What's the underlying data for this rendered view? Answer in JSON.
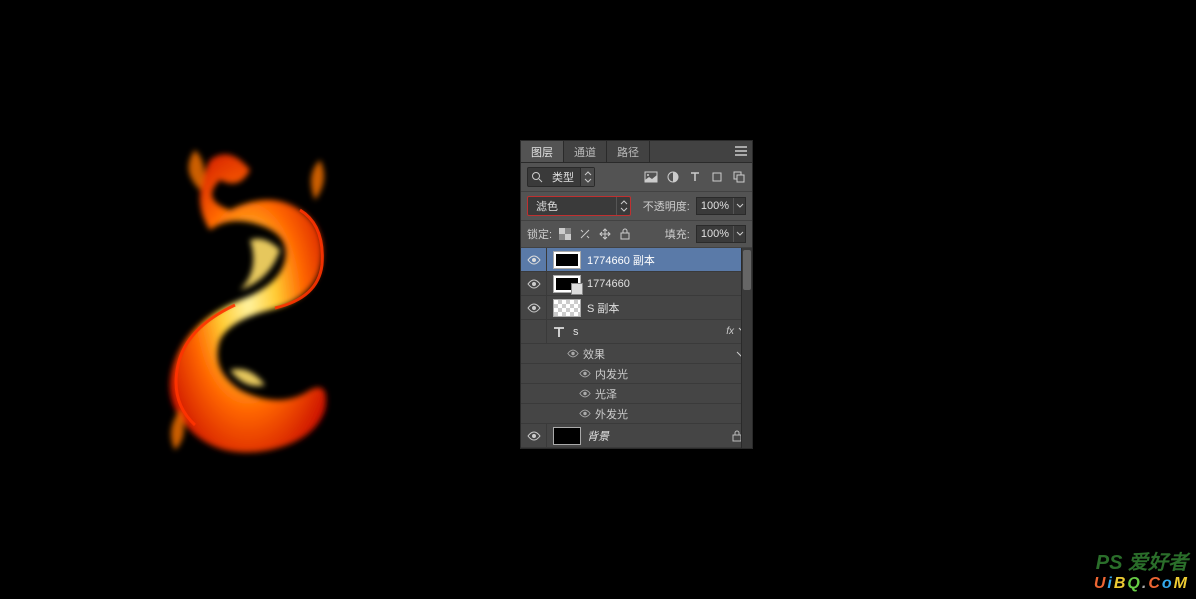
{
  "tabs": {
    "layers": "图层",
    "channels": "通道",
    "paths": "路径"
  },
  "filter": {
    "type_label": "类型"
  },
  "blend": {
    "mode": "滤色",
    "opacity_label": "不透明度:",
    "opacity_value": "100%"
  },
  "lock": {
    "label": "锁定:",
    "fill_label": "填充:",
    "fill_value": "100%"
  },
  "layers": [
    {
      "name": "1774660 副本"
    },
    {
      "name": "1774660"
    },
    {
      "name": "S 副本"
    },
    {
      "name": "s",
      "fx": "fx"
    },
    {
      "name": "背景"
    }
  ],
  "effects": {
    "header": "效果",
    "items": [
      "内发光",
      "光泽",
      "外发光"
    ]
  },
  "watermark": {
    "line1": "PS 爱好者",
    "line2": "UiBQ.CoM"
  }
}
